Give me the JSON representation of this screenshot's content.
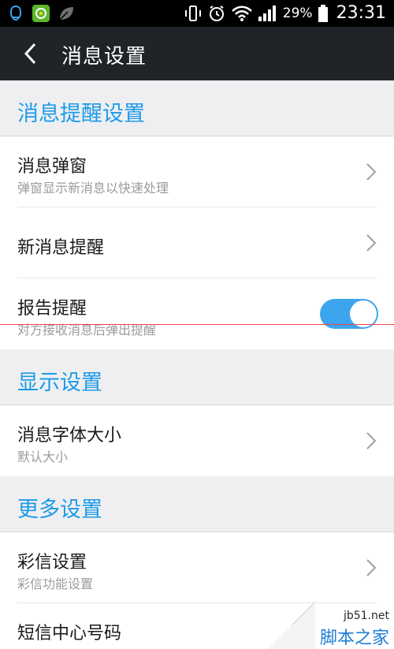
{
  "status_bar": {
    "battery_percent": "29%",
    "time": "23:31",
    "icons": [
      "qq-notification-icon",
      "app-store-icon",
      "leaf-icon",
      "vibrate-icon",
      "alarm-icon",
      "wifi-icon",
      "signal-icon",
      "battery-icon"
    ]
  },
  "header": {
    "title": "消息设置",
    "back_icon": "chevron-left-icon"
  },
  "sections": [
    {
      "header": "消息提醒设置",
      "items": [
        {
          "title": "消息弹窗",
          "subtitle": "弹窗显示新消息以快速处理",
          "control": "chevron"
        },
        {
          "title": "新消息提醒",
          "control": "chevron"
        },
        {
          "title": "报告提醒",
          "subtitle": "对方接收消息后弹出提醒",
          "control": "toggle",
          "toggle_on": true
        }
      ]
    },
    {
      "header": "显示设置",
      "items": [
        {
          "title": "消息字体大小",
          "subtitle": "默认大小",
          "control": "chevron"
        }
      ]
    },
    {
      "header": "更多设置",
      "items": [
        {
          "title": "彩信设置",
          "subtitle": "彩信功能设置",
          "control": "chevron"
        },
        {
          "title": "短信中心号码",
          "control": "none"
        }
      ]
    }
  ],
  "watermark": {
    "url": "jb51.net",
    "name": "脚本之家"
  },
  "colors": {
    "accent": "#1e9be7",
    "toggle_on": "#3da5ee",
    "title_bar": "#202428",
    "status_bar": "#000000",
    "background": "#efeff2"
  }
}
